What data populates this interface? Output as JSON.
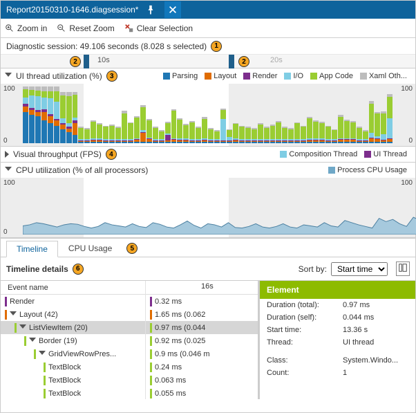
{
  "title": "Report20150310-1646.diagsession*",
  "toolbar": {
    "zoom_in": "Zoom in",
    "reset_zoom": "Reset Zoom",
    "clear_sel": "Clear Selection"
  },
  "session_line": "Diagnostic session: 49.106 seconds (8.028 s selected)",
  "callouts": {
    "c1": "1",
    "c2a": "2",
    "c2b": "2",
    "c3": "3",
    "c4": "4",
    "c5": "5",
    "c6": "6"
  },
  "ruler": {
    "t10": "10s",
    "t20": "20s"
  },
  "lane_ui": {
    "title": "UI thread utilization (%)",
    "legend": [
      {
        "label": "Parsing",
        "color": "#1f77b4"
      },
      {
        "label": "Layout",
        "color": "#e06c00"
      },
      {
        "label": "Render",
        "color": "#7d2e8d"
      },
      {
        "label": "I/O",
        "color": "#7fcde4"
      },
      {
        "label": "App Code",
        "color": "#9acd32"
      },
      {
        "label": "Xaml Oth...",
        "color": "#bdbdbd"
      }
    ],
    "y_top": "100",
    "y_bot": "0"
  },
  "lane_vt": {
    "title": "Visual throughput (FPS)",
    "legend": [
      {
        "label": "Composition Thread",
        "color": "#7fcde4"
      },
      {
        "label": "UI Thread",
        "color": "#7d2e8d"
      }
    ]
  },
  "lane_cpu": {
    "title": "CPU utilization (% of all processors)",
    "legend": [
      {
        "label": "Process CPU Usage",
        "color": "#6fa8c7"
      }
    ],
    "y_top": "100",
    "y_bot": "0"
  },
  "tabs": {
    "timeline": "Timeline",
    "cpu": "CPU Usage"
  },
  "details_bar": {
    "title": "Timeline details",
    "sort_by": "Sort by:",
    "sort_value": "Start time"
  },
  "tree": {
    "col_header": "Event name",
    "tl_header": "16s",
    "rows": [
      {
        "indent": 0,
        "tick": "#7d2e8d",
        "exp": "",
        "label": "Render",
        "bar": "#7d2e8d",
        "dur": "0.32 ms"
      },
      {
        "indent": 0,
        "tick": "#e06c00",
        "exp": "down",
        "label": "Layout (42)",
        "bar": "#e06c00",
        "dur": "1.65 ms (0.062"
      },
      {
        "indent": 1,
        "tick": "#9acd32",
        "exp": "down",
        "label": "ListViewItem (20)",
        "bar": "#9acd32",
        "dur": "0.97 ms (0.044",
        "sel": true
      },
      {
        "indent": 2,
        "tick": "#9acd32",
        "exp": "down",
        "label": "Border (19)",
        "bar": "#9acd32",
        "dur": "0.92 ms (0.025"
      },
      {
        "indent": 3,
        "tick": "#9acd32",
        "exp": "down",
        "label": "GridViewRowPres...",
        "bar": "#9acd32",
        "dur": "0.9 ms (0.046 m"
      },
      {
        "indent": 4,
        "tick": "#9acd32",
        "exp": "",
        "label": "TextBlock",
        "bar": "#9acd32",
        "dur": "0.24 ms"
      },
      {
        "indent": 4,
        "tick": "#9acd32",
        "exp": "",
        "label": "TextBlock",
        "bar": "#9acd32",
        "dur": "0.063 ms"
      },
      {
        "indent": 4,
        "tick": "#9acd32",
        "exp": "",
        "label": "TextBlock",
        "bar": "#9acd32",
        "dur": "0.055 ms"
      }
    ]
  },
  "props": {
    "title": "Element",
    "rows": [
      {
        "k": "Duration (total):",
        "v": "0.97 ms"
      },
      {
        "k": "Duration (self):",
        "v": "0.044 ms"
      },
      {
        "k": "Start time:",
        "v": "13.36 s"
      },
      {
        "k": "Thread:",
        "v": "UI thread"
      }
    ],
    "rows2": [
      {
        "k": "Class:",
        "v": "System.Windo..."
      },
      {
        "k": "Count:",
        "v": "1"
      }
    ]
  },
  "chart_data": [
    {
      "type": "bar",
      "title": "UI thread utilization (%)",
      "ylim": [
        0,
        100
      ],
      "series_colors": {
        "Parsing": "#1f77b4",
        "Layout": "#e06c00",
        "Render": "#7d2e8d",
        "I/O": "#7fcde4",
        "App Code": "#9acd32",
        "Xaml Other": "#bdbdbd"
      },
      "note": "Stacked per-time-slice utilization; approximate values read from chart.",
      "stacked_bars": [
        {
          "Parsing": 55,
          "Layout": 10,
          "Render": 5,
          "I/O": 10,
          "App Code": 15,
          "Xaml Other": 5
        },
        {
          "Parsing": 50,
          "Layout": 8,
          "Render": 4,
          "I/O": 22,
          "App Code": 10,
          "Xaml Other": 6
        },
        {
          "Parsing": 48,
          "Layout": 7,
          "Render": 3,
          "I/O": 25,
          "App Code": 10,
          "Xaml Other": 7
        },
        {
          "Parsing": 40,
          "Layout": 15,
          "Render": 5,
          "I/O": 20,
          "App Code": 12,
          "Xaml Other": 8
        },
        {
          "Parsing": 35,
          "Layout": 12,
          "Render": 4,
          "I/O": 28,
          "App Code": 13,
          "Xaml Other": 8
        },
        {
          "Parsing": 30,
          "Layout": 10,
          "Render": 3,
          "I/O": 30,
          "App Code": 18,
          "Xaml Other": 9
        },
        {
          "Parsing": 25,
          "Layout": 8,
          "Render": 3,
          "I/O": 8,
          "App Code": 40,
          "Xaml Other": 6
        },
        {
          "Parsing": 20,
          "Layout": 6,
          "Render": 3,
          "I/O": 6,
          "App Code": 48,
          "Xaml Other": 7
        },
        {
          "Parsing": 15,
          "Layout": 20,
          "Render": 5,
          "I/O": 5,
          "App Code": 40,
          "Xaml Other": 5
        },
        {
          "Parsing": 2,
          "Layout": 2,
          "Render": 1,
          "I/O": 2,
          "App Code": 20,
          "Xaml Other": 2
        },
        {
          "Parsing": 2,
          "Layout": 2,
          "Render": 1,
          "I/O": 2,
          "App Code": 18,
          "Xaml Other": 2
        },
        {
          "Parsing": 2,
          "Layout": 3,
          "Render": 1,
          "I/O": 2,
          "App Code": 30,
          "Xaml Other": 2
        },
        {
          "Parsing": 2,
          "Layout": 3,
          "Render": 1,
          "I/O": 2,
          "App Code": 25,
          "Xaml Other": 3
        },
        {
          "Parsing": 2,
          "Layout": 2,
          "Render": 1,
          "I/O": 2,
          "App Code": 22,
          "Xaml Other": 2
        },
        {
          "Parsing": 2,
          "Layout": 2,
          "Render": 1,
          "I/O": 2,
          "App Code": 24,
          "Xaml Other": 2
        },
        {
          "Parsing": 2,
          "Layout": 2,
          "Render": 1,
          "I/O": 2,
          "App Code": 20,
          "Xaml Other": 2
        },
        {
          "Parsing": 2,
          "Layout": 2,
          "Render": 1,
          "I/O": 2,
          "App Code": 45,
          "Xaml Other": 5
        },
        {
          "Parsing": 2,
          "Layout": 2,
          "Render": 1,
          "I/O": 2,
          "App Code": 28,
          "Xaml Other": 2
        },
        {
          "Parsing": 2,
          "Layout": 4,
          "Render": 1,
          "I/O": 2,
          "App Code": 36,
          "Xaml Other": 3
        },
        {
          "Parsing": 3,
          "Layout": 15,
          "Render": 2,
          "I/O": 3,
          "App Code": 40,
          "Xaml Other": 4
        },
        {
          "Parsing": 2,
          "Layout": 5,
          "Render": 1,
          "I/O": 2,
          "App Code": 30,
          "Xaml Other": 3
        },
        {
          "Parsing": 2,
          "Layout": 2,
          "Render": 1,
          "I/O": 2,
          "App Code": 20,
          "Xaml Other": 2
        },
        {
          "Parsing": 2,
          "Layout": 2,
          "Render": 1,
          "I/O": 2,
          "App Code": 14,
          "Xaml Other": 2
        },
        {
          "Parsing": 2,
          "Layout": 3,
          "Render": 10,
          "I/O": 2,
          "App Code": 18,
          "Xaml Other": 3
        },
        {
          "Parsing": 2,
          "Layout": 4,
          "Render": 1,
          "I/O": 2,
          "App Code": 48,
          "Xaml Other": 3
        },
        {
          "Parsing": 2,
          "Layout": 3,
          "Render": 1,
          "I/O": 2,
          "App Code": 34,
          "Xaml Other": 2
        },
        {
          "Parsing": 2,
          "Layout": 3,
          "Render": 1,
          "I/O": 2,
          "App Code": 24,
          "Xaml Other": 2
        },
        {
          "Parsing": 2,
          "Layout": 2,
          "Render": 1,
          "I/O": 2,
          "App Code": 30,
          "Xaml Other": 2
        },
        {
          "Parsing": 2,
          "Layout": 2,
          "Render": 1,
          "I/O": 2,
          "App Code": 20,
          "Xaml Other": 2
        },
        {
          "Parsing": 2,
          "Layout": 3,
          "Render": 1,
          "I/O": 2,
          "App Code": 35,
          "Xaml Other": 3
        },
        {
          "Parsing": 2,
          "Layout": 2,
          "Render": 1,
          "I/O": 2,
          "App Code": 18,
          "Xaml Other": 2
        },
        {
          "Parsing": 2,
          "Layout": 2,
          "Render": 1,
          "I/O": 2,
          "App Code": 14,
          "Xaml Other": 2
        },
        {
          "Parsing": 2,
          "Layout": 2,
          "Render": 1,
          "I/O": 38,
          "App Code": 16,
          "Xaml Other": 2
        },
        {
          "Parsing": 2,
          "Layout": 2,
          "Render": 1,
          "I/O": 6,
          "App Code": 12,
          "Xaml Other": 2
        },
        {
          "Parsing": 2,
          "Layout": 3,
          "Render": 1,
          "I/O": 2,
          "App Code": 26,
          "Xaml Other": 2
        },
        {
          "Parsing": 2,
          "Layout": 2,
          "Render": 1,
          "I/O": 2,
          "App Code": 22,
          "Xaml Other": 2
        },
        {
          "Parsing": 2,
          "Layout": 2,
          "Render": 1,
          "I/O": 2,
          "App Code": 20,
          "Xaml Other": 2
        },
        {
          "Parsing": 2,
          "Layout": 2,
          "Render": 1,
          "I/O": 2,
          "App Code": 18,
          "Xaml Other": 2
        },
        {
          "Parsing": 2,
          "Layout": 2,
          "Render": 1,
          "I/O": 2,
          "App Code": 26,
          "Xaml Other": 2
        },
        {
          "Parsing": 2,
          "Layout": 2,
          "Render": 1,
          "I/O": 2,
          "App Code": 20,
          "Xaml Other": 2
        },
        {
          "Parsing": 2,
          "Layout": 2,
          "Render": 1,
          "I/O": 2,
          "App Code": 24,
          "Xaml Other": 2
        },
        {
          "Parsing": 2,
          "Layout": 2,
          "Render": 1,
          "I/O": 2,
          "App Code": 30,
          "Xaml Other": 2
        },
        {
          "Parsing": 2,
          "Layout": 2,
          "Render": 1,
          "I/O": 2,
          "App Code": 20,
          "Xaml Other": 2
        },
        {
          "Parsing": 2,
          "Layout": 2,
          "Render": 1,
          "I/O": 2,
          "App Code": 18,
          "Xaml Other": 2
        },
        {
          "Parsing": 2,
          "Layout": 2,
          "Render": 1,
          "I/O": 2,
          "App Code": 28,
          "Xaml Other": 2
        },
        {
          "Parsing": 2,
          "Layout": 2,
          "Render": 1,
          "I/O": 2,
          "App Code": 22,
          "Xaml Other": 2
        },
        {
          "Parsing": 2,
          "Layout": 3,
          "Render": 1,
          "I/O": 2,
          "App Code": 36,
          "Xaml Other": 3
        },
        {
          "Parsing": 2,
          "Layout": 3,
          "Render": 1,
          "I/O": 2,
          "App Code": 30,
          "Xaml Other": 2
        },
        {
          "Parsing": 2,
          "Layout": 3,
          "Render": 1,
          "I/O": 2,
          "App Code": 28,
          "Xaml Other": 2
        },
        {
          "Parsing": 2,
          "Layout": 2,
          "Render": 1,
          "I/O": 2,
          "App Code": 22,
          "Xaml Other": 2
        },
        {
          "Parsing": 2,
          "Layout": 2,
          "Render": 1,
          "I/O": 2,
          "App Code": 16,
          "Xaml Other": 2
        },
        {
          "Parsing": 2,
          "Layout": 4,
          "Render": 1,
          "I/O": 2,
          "App Code": 38,
          "Xaml Other": 3
        },
        {
          "Parsing": 3,
          "Layout": 3,
          "Render": 1,
          "I/O": 2,
          "App Code": 30,
          "Xaml Other": 2
        },
        {
          "Parsing": 3,
          "Layout": 3,
          "Render": 1,
          "I/O": 2,
          "App Code": 28,
          "Xaml Other": 2
        },
        {
          "Parsing": 2,
          "Layout": 2,
          "Render": 1,
          "I/O": 2,
          "App Code": 20,
          "Xaml Other": 2
        },
        {
          "Parsing": 2,
          "Layout": 2,
          "Render": 1,
          "I/O": 2,
          "App Code": 14,
          "Xaml Other": 2
        },
        {
          "Parsing": 3,
          "Layout": 5,
          "Render": 2,
          "I/O": 8,
          "App Code": 52,
          "Xaml Other": 5
        },
        {
          "Parsing": 3,
          "Layout": 4,
          "Render": 1,
          "I/O": 4,
          "App Code": 40,
          "Xaml Other": 3
        },
        {
          "Parsing": 2,
          "Layout": 3,
          "Render": 1,
          "I/O": 10,
          "App Code": 36,
          "Xaml Other": 4
        },
        {
          "Parsing": 2,
          "Layout": 5,
          "Render": 2,
          "I/O": 35,
          "App Code": 38,
          "Xaml Other": 5
        }
      ]
    },
    {
      "type": "area",
      "title": "CPU utilization (% of all processors)",
      "ylim": [
        0,
        100
      ],
      "series": [
        {
          "name": "Process CPU Usage",
          "color": "#6fa8c7",
          "values": [
            16,
            18,
            22,
            20,
            17,
            14,
            18,
            20,
            19,
            15,
            12,
            15,
            22,
            18,
            16,
            14,
            20,
            15,
            13,
            22,
            19,
            14,
            12,
            18,
            25,
            17,
            12,
            20,
            18,
            14,
            22,
            13,
            12,
            15,
            20,
            14,
            12,
            15,
            20,
            14,
            12,
            18,
            16,
            14,
            22,
            16,
            14,
            26,
            22,
            18,
            15,
            12,
            30,
            24,
            28,
            20,
            15,
            32,
            26,
            22
          ]
        }
      ]
    }
  ]
}
